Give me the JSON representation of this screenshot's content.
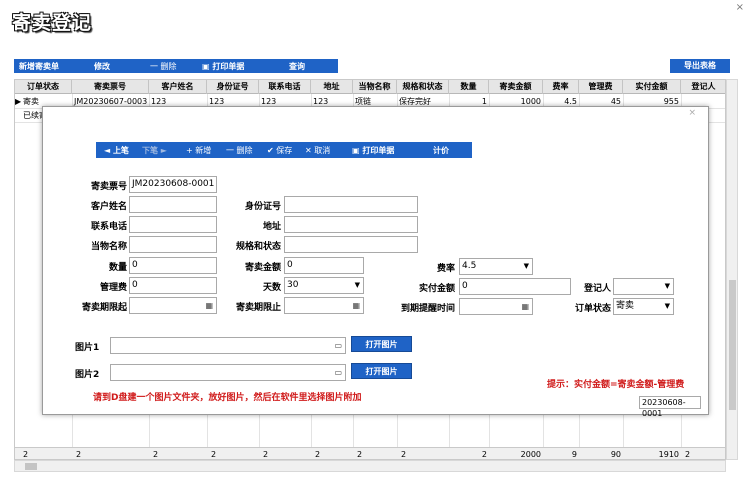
{
  "app": {
    "title": "寄卖登记",
    "close_glyph": "×"
  },
  "toolbar": {
    "new_label": "新增寄卖单",
    "edit_label": "修改",
    "delete_label": "一 删除",
    "print_label": "打印单据",
    "query_label": "查询",
    "export_label": "导出表格"
  },
  "grid": {
    "columns": [
      "订单状态",
      "寄卖票号",
      "客户姓名",
      "身份证号",
      "联系电话",
      "地址",
      "当物名称",
      "规格和状态",
      "数量",
      "寄卖金额",
      "费率",
      "管理费",
      "实付金额",
      "登记人"
    ],
    "rows": [
      {
        "indicator": "▶",
        "cells": [
          "寄卖",
          "JM20230607-0003",
          "123",
          "123",
          "123",
          "123",
          "项链",
          "保存完好",
          "1",
          "1000",
          "4.5",
          "45",
          "955",
          ""
        ]
      }
    ],
    "second_row_text": "已续寄",
    "summary": [
      "2",
      "2",
      "2",
      "2",
      "2",
      "2",
      "2",
      "2",
      "2",
      "2000",
      "9",
      "90",
      "1910",
      "2"
    ]
  },
  "dialog": {
    "close_glyph": "×",
    "toolbar": {
      "prev": "◄ 上笔",
      "next": "下笔 ►",
      "new": "+ 新增",
      "delete": "一 删除",
      "save": "✔ 保存",
      "cancel": "✕ 取消",
      "print": "打印单据",
      "calc": "计价"
    },
    "labels": {
      "ticket_no": "寄卖票号",
      "customer_name": "客户姓名",
      "id_no": "身份证号",
      "phone": "联系电话",
      "address": "地址",
      "item_name": "当物名称",
      "spec": "规格和状态",
      "quantity": "数量",
      "amount": "寄卖金额",
      "rate": "费率",
      "fee": "管理费",
      "days": "天数",
      "paid": "实付金额",
      "registrar": "登记人",
      "start": "寄卖期限起",
      "end": "寄卖期限止",
      "remind": "到期提醒时间",
      "status": "订单状态",
      "image1": "图片1",
      "image2": "图片2"
    },
    "values": {
      "ticket_no": "JM20230608-0001",
      "customer_name": "",
      "id_no": "",
      "phone": "",
      "address": "",
      "item_name": "",
      "spec": "",
      "quantity": "0",
      "amount": "0",
      "rate": "4.5",
      "fee": "0",
      "days": "30",
      "paid": "0",
      "registrar": "",
      "start": "",
      "end": "",
      "remind": "",
      "status": "寄卖",
      "image1": "",
      "image2": ""
    },
    "open_image_label": "打开图片",
    "hint": "提示：实付金额=寄卖金额-管理费",
    "instruction": "请到D盘建一个图片文件夹，放好图片，然后在软件里选择图片附加",
    "footer_ticket": "20230608-0001"
  }
}
